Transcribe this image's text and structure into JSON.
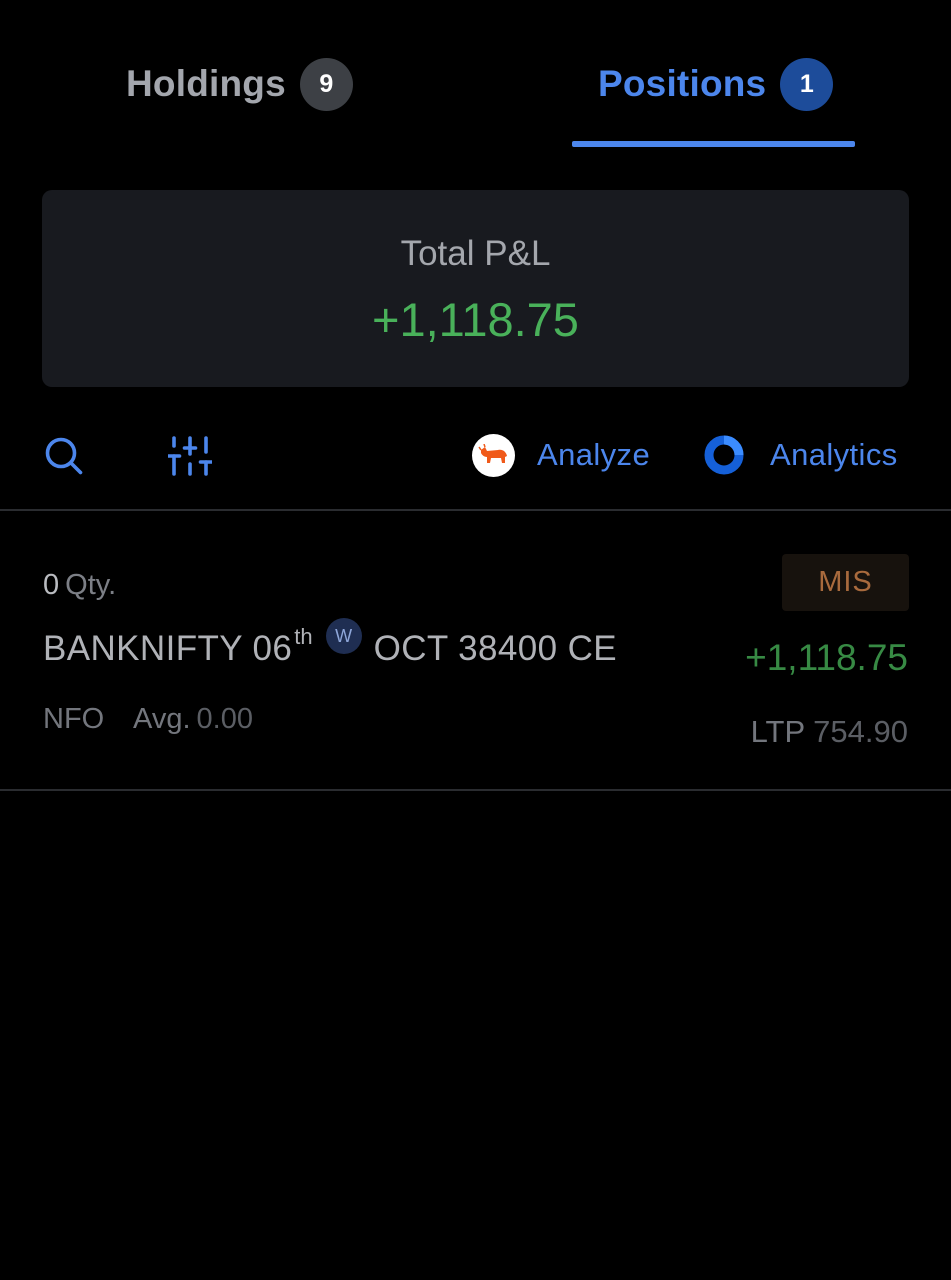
{
  "tabs": [
    {
      "label": "Holdings",
      "count": "9"
    },
    {
      "label": "Positions",
      "count": "1"
    }
  ],
  "active_tab": "Positions",
  "summary": {
    "title": "Total P&L",
    "value": "+1,118.75"
  },
  "toolbar": {
    "search_icon": "search-icon",
    "filter_icon": "sliders-icon",
    "analyze_label": "Analyze",
    "analyze_icon": "bull-logo-icon",
    "analytics_label": "Analytics",
    "analytics_icon": "ring-logo-icon"
  },
  "positions": [
    {
      "qty": "0",
      "qty_label": "Qty.",
      "product": "MIS",
      "symbol": "BANKNIFTY 06",
      "symbol_suffix": "th",
      "expiry_badge": "W",
      "symbol_rest": "OCT 38400 CE",
      "pnl": "+1,118.75",
      "exchange": "NFO",
      "avg_label": "Avg.",
      "avg_value": "0.00",
      "ltp_label": "LTP",
      "ltp_value": "754.90"
    }
  ],
  "colors": {
    "accent": "#4c86ec",
    "profit": "#49b15a",
    "background": "#000000",
    "card": "#181a1f"
  }
}
